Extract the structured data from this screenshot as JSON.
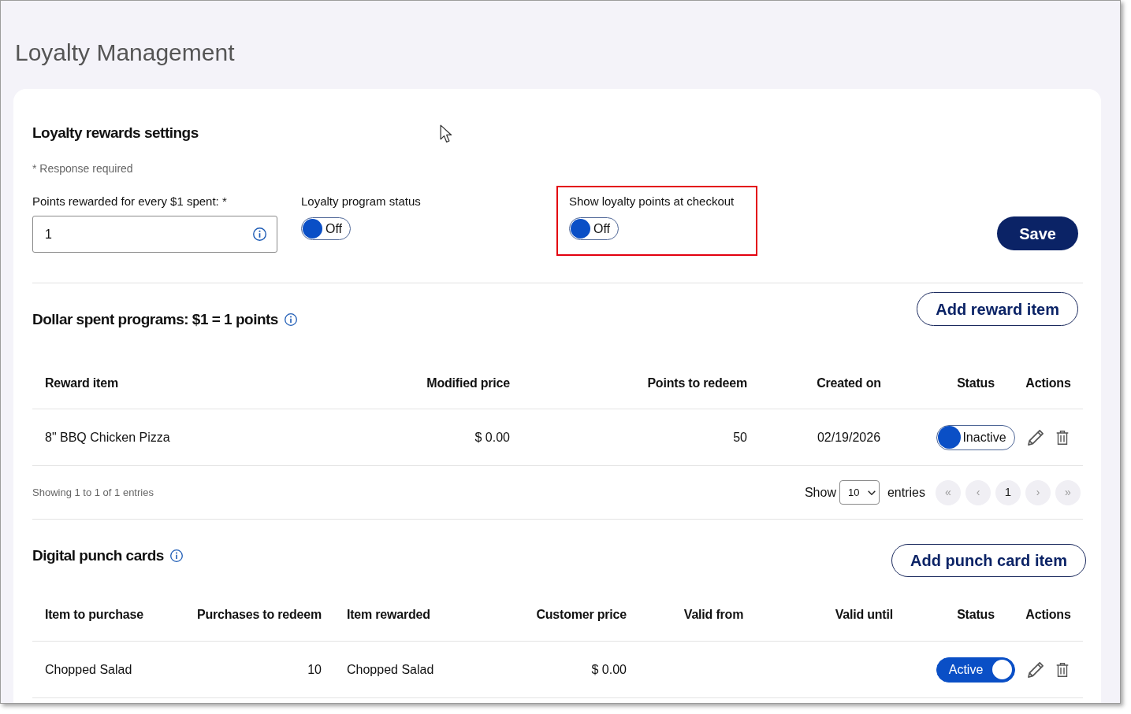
{
  "page": {
    "title": "Loyalty Management"
  },
  "settings": {
    "heading": "Loyalty rewards settings",
    "note": "* Response required",
    "points_field": {
      "label": "Points rewarded for every $1 spent: *",
      "value": "1"
    },
    "toggles": [
      {
        "label": "Loyalty program status",
        "on": false,
        "text": "Off",
        "highlighted": false
      },
      {
        "label": "Show loyalty points at checkout",
        "on": false,
        "text": "Off",
        "highlighted": true
      }
    ],
    "save_button": "Save"
  },
  "dollar_programs": {
    "heading": "Dollar spent programs: $1 = 1 points",
    "add_button": "Add reward item",
    "columns": [
      {
        "label": "Reward item",
        "kind": "text"
      },
      {
        "label": "Modified price",
        "kind": "text"
      },
      {
        "label": "Points to redeem",
        "kind": "text"
      },
      {
        "label": "Created on",
        "kind": "text"
      },
      {
        "label": "Status",
        "kind": "status"
      },
      {
        "label": "Actions",
        "kind": "actions"
      }
    ],
    "rows": [
      {
        "cells": [
          "8\" BBQ Chicken Pizza",
          "$ 0.00",
          "50",
          "02/19/2026"
        ],
        "status": {
          "on": false,
          "text": "Inactive"
        }
      }
    ],
    "footer": {
      "summary": "Showing 1 to 1 of 1 entries",
      "show_label": "Show",
      "page_size": "10",
      "entries_label": "entries",
      "pages": [
        {
          "label": "«",
          "disabled": true
        },
        {
          "label": "‹",
          "disabled": true
        },
        {
          "label": "1",
          "disabled": false
        },
        {
          "label": "›",
          "disabled": true
        },
        {
          "label": "»",
          "disabled": true
        }
      ]
    }
  },
  "punch_cards": {
    "heading": "Digital punch cards",
    "add_button": "Add punch card item",
    "columns": [
      {
        "label": "Item to purchase",
        "kind": "text"
      },
      {
        "label": "Purchases to redeem",
        "kind": "text"
      },
      {
        "label": "Item rewarded",
        "kind": "text"
      },
      {
        "label": "Customer price",
        "kind": "text"
      },
      {
        "label": "Valid from",
        "kind": "text"
      },
      {
        "label": "Valid until",
        "kind": "text"
      },
      {
        "label": "Status",
        "kind": "status"
      },
      {
        "label": "Actions",
        "kind": "actions"
      }
    ],
    "rows": [
      {
        "cells": [
          "Chopped Salad",
          "10",
          "Chopped Salad",
          "$ 0.00"
        ],
        "status": {
          "on": true,
          "text": "Active"
        }
      }
    ]
  }
}
